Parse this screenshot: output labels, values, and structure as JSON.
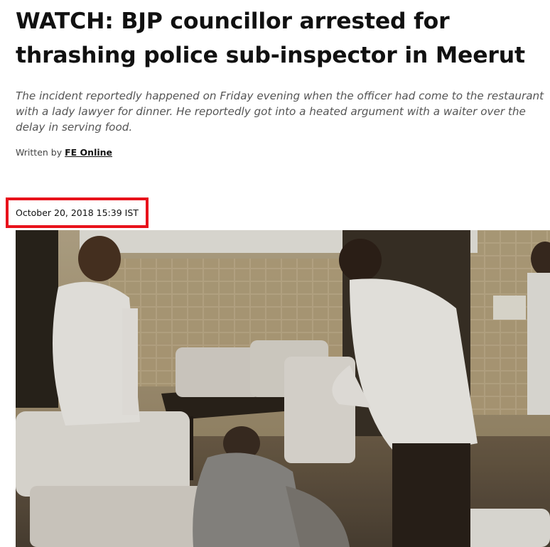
{
  "article": {
    "headline": "WATCH: BJP councillor arrested for thrashing police sub-inspector in Meerut",
    "summary": "The incident reportedly happened on Friday evening when the officer had come to the restaurant with a lady lawyer for dinner. He reportedly got into a heated argument with a waiter over the delay in serving food.",
    "byline_prefix": "Written by ",
    "author": "FE Online",
    "date": "October 20, 2018 15:39 IST"
  },
  "colors": {
    "highlight_box": "#e8121b",
    "summary_text": "#555555"
  }
}
